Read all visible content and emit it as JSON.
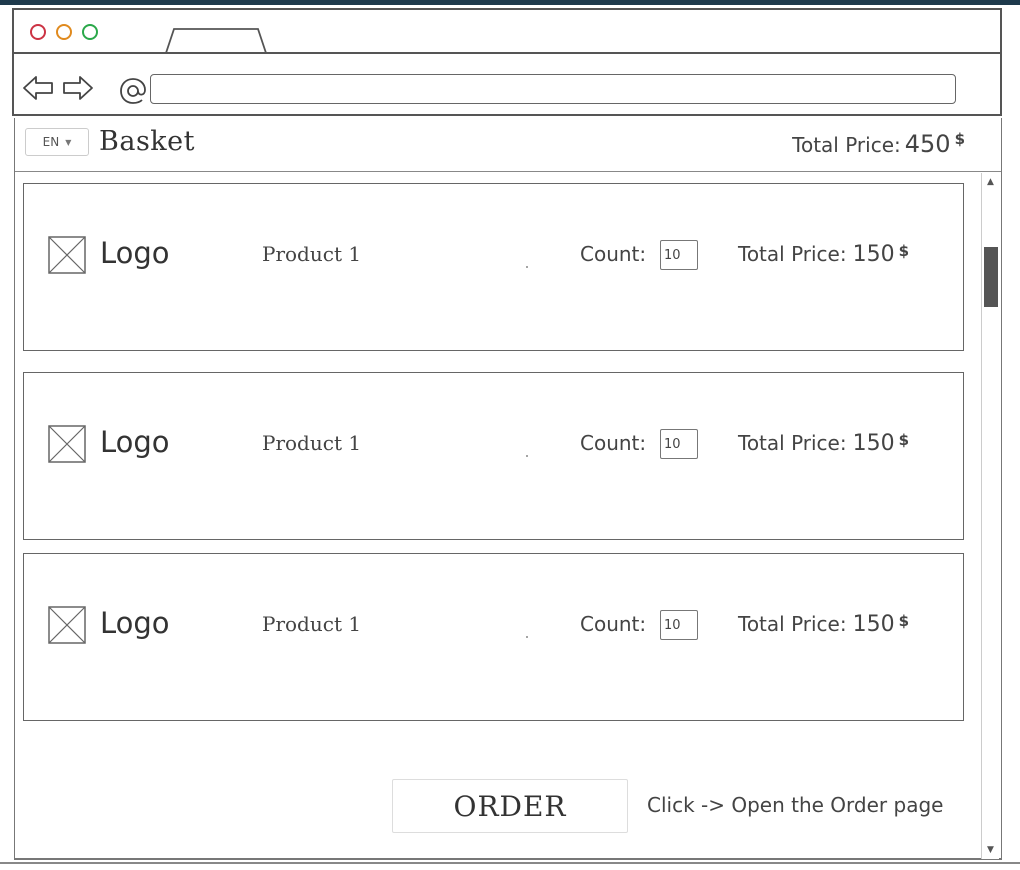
{
  "browser": {
    "window_buttons": [
      "close-dot",
      "minimize-dot",
      "maximize-dot"
    ],
    "url": ""
  },
  "header": {
    "language": "EN",
    "title": "Basket",
    "total_label": "Total Price:",
    "total_value": "450",
    "currency_symbol": "$"
  },
  "items": [
    {
      "logo_text": "Logo",
      "product_name": "Product 1",
      "count_label": "Count:",
      "count_value": "10",
      "total_label": "Total Price:",
      "total_value": "150",
      "currency_symbol": "$"
    },
    {
      "logo_text": "Logo",
      "product_name": "Product 1",
      "count_label": "Count:",
      "count_value": "10",
      "total_label": "Total Price:",
      "total_value": "150",
      "currency_symbol": "$"
    },
    {
      "logo_text": "Logo",
      "product_name": "Product 1",
      "count_label": "Count:",
      "count_value": "10",
      "total_label": "Total Price:",
      "total_value": "150",
      "currency_symbol": "$"
    }
  ],
  "order": {
    "button_label": "ORDER",
    "note": "Click -> Open the Order page"
  },
  "colors": {
    "close": "#cc3344",
    "minimize": "#e08a1e",
    "maximize": "#2aa84a",
    "top_strip": "#1e3a4c"
  }
}
